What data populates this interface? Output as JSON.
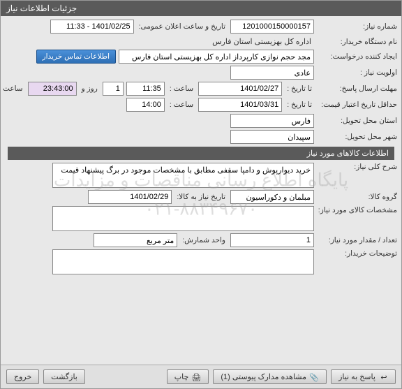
{
  "window": {
    "title": "جزئیات اطلاعات نیاز"
  },
  "watermark": {
    "line1": "پایگاه اطلاع رسانی مناقصات و مزایدات",
    "line2": "۰۲۱-۸۸۳۴۹۶۷۰"
  },
  "sec1": {
    "need_no_label": "شماره نیاز:",
    "need_no": "1201000150000157",
    "announce_label": "تاریخ و ساعت اعلان عمومی:",
    "announce_value": "1401/02/25 - 11:33",
    "buyer_label": "نام دستگاه خریدار:",
    "buyer": "اداره کل بهزیستی استان فارس",
    "creator_label": "ایجاد کننده درخواست:",
    "creator": "مجد حجم نوازی کارپرداز اداره کل بهزیستی استان فارس",
    "contact_btn": "اطلاعات تماس خریدار",
    "priority_label": "اولویت نیاز :",
    "priority": "عادی",
    "deadline_label": "مهلت ارسال پاسخ:",
    "until_label": "تا تاریخ :",
    "deadline_date": "1401/02/27",
    "time_label": "ساعت :",
    "deadline_time": "11:35",
    "days": "1",
    "days_label": "روز و",
    "remain_time": "23:43:00",
    "remain_label": "ساعت باقی مانده",
    "validity_label": "حداقل تاریخ اعتبار قیمت:",
    "validity_date": "1401/03/31",
    "validity_time": "14:00",
    "province_label": "استان محل تحویل:",
    "province": "فارس",
    "city_label": "شهر محل تحویل:",
    "city": "سپیدان"
  },
  "sec2": {
    "header": "اطلاعات کالاهای مورد نیاز",
    "desc_label": "شرح کلی نیاز:",
    "desc": "خرید دیوارپوش و دامپا سقفی مطابق با مشخصات موجود در برگ پیشنهاد قیمت",
    "group_label": "گروه کالا:",
    "group": "مبلمان و دکوراسیون",
    "need_date_label": "تاریخ نیاز به کالا:",
    "need_date": "1401/02/29",
    "spec_label": "مشخصات کالای مورد نیاز:",
    "spec": "",
    "qty_label": "تعداد / مقدار مورد نیاز:",
    "qty": "1",
    "unit_label": "واحد شمارش:",
    "unit": "متر مربع",
    "notes_label": "توضیحات خریدار:",
    "notes": ""
  },
  "toolbar": {
    "respond": "پاسخ به نیاز",
    "attachments": "مشاهده مدارک پیوستی (1)",
    "print": "چاپ",
    "back": "بازگشت",
    "exit": "خروج"
  }
}
